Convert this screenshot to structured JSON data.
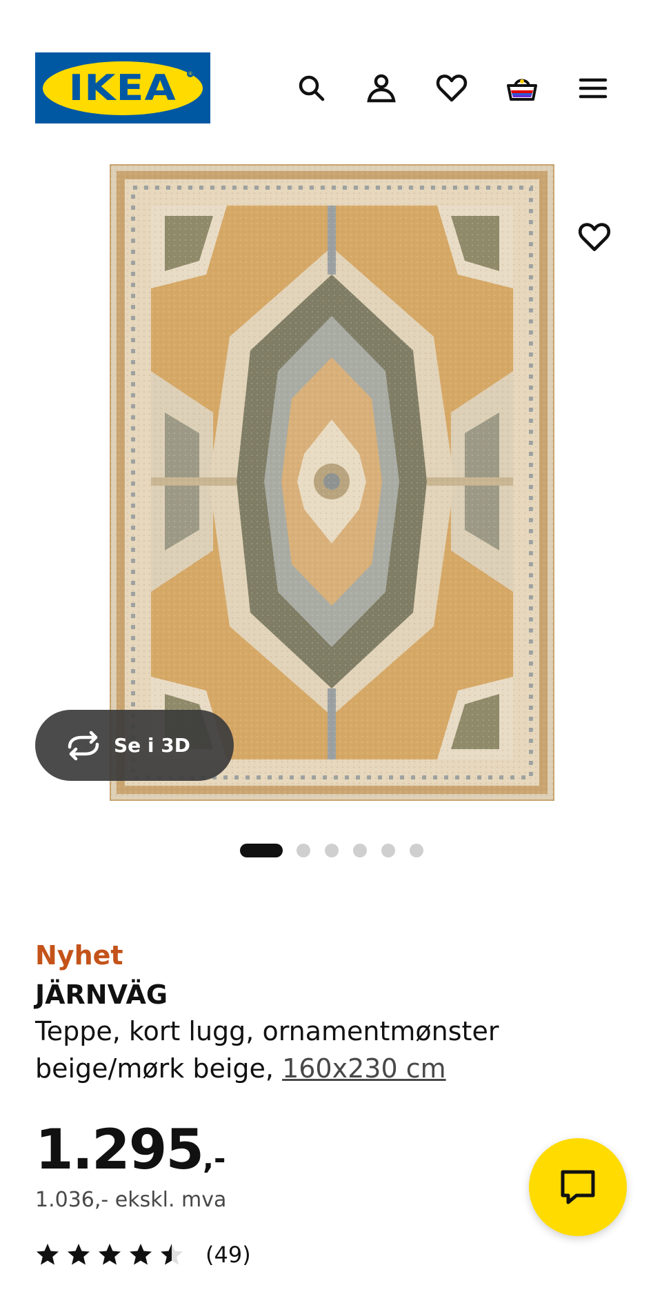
{
  "header": {
    "logo_text": "IKEA",
    "logo_colors": {
      "background": "#0058a3",
      "oval": "#ffdb00"
    },
    "icons": [
      "search-icon",
      "account-icon",
      "favourites-icon",
      "cart-icon",
      "menu-icon"
    ]
  },
  "gallery": {
    "view_3d_label": "Se i 3D",
    "image_count": 6,
    "active_image": 1
  },
  "product": {
    "badge": "Nyhet",
    "name": "JÄRNVÄG",
    "description_line1": "Teppe, kort lugg, ornamentmønster",
    "description_line2": "beige/mørk beige,",
    "size": "160x230 cm",
    "price_main": "1.295",
    "price_suffix": ",-",
    "price_excl_vat": "1.036,- ekskl. mva",
    "rating_value": 4.5,
    "rating_max": 5,
    "review_count": "(49)"
  },
  "colors": {
    "accent_new": "#c4531a",
    "chat_button": "#ffdb00"
  }
}
